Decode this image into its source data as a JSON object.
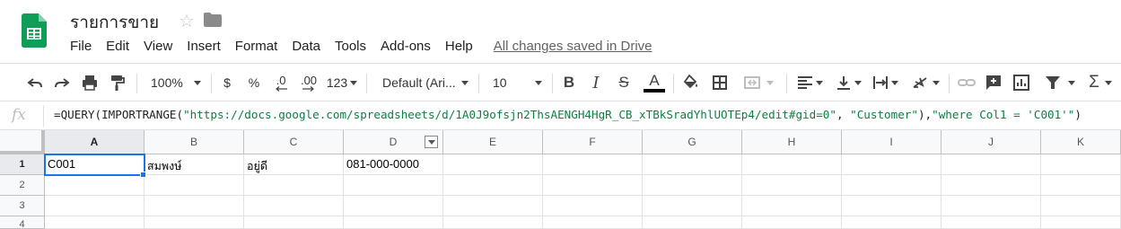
{
  "app": {
    "doc_title": "รายการขาย",
    "star_icon": "star-icon",
    "folder_icon": "folder-icon",
    "accent_color": "#0f9d58"
  },
  "menu": {
    "items": [
      "File",
      "Edit",
      "View",
      "Insert",
      "Format",
      "Data",
      "Tools",
      "Add-ons",
      "Help"
    ],
    "save_status": "All changes saved in Drive"
  },
  "toolbar": {
    "zoom": "100%",
    "currency": "$",
    "percent": "%",
    "decimal_decrease": ".0",
    "decimal_increase": ".00",
    "more_formats": "123",
    "font": "Default (Ari...",
    "font_size": "10",
    "bold": "B",
    "italic": "I",
    "strike": "S",
    "text_color_letter": "A"
  },
  "formula_bar": {
    "fx_label": "fx",
    "prefix": "=QUERY(IMPORTRANGE(",
    "url": "\"https://docs.google.com/spreadsheets/d/1A0J9ofsjn2ThsAENGH4HgR_CB_xTBkSradYhlUOTEp4/edit#gid=0\"",
    "middle": ", ",
    "sheet": "\"Customer\"",
    "mid2": "),",
    "query": "\"where Col1 = 'C001'\"",
    "suffix": ")"
  },
  "grid": {
    "columns": [
      "A",
      "B",
      "C",
      "D",
      "E",
      "F",
      "G",
      "H",
      "I",
      "J",
      "K"
    ],
    "rows": [
      "1",
      "2",
      "3",
      "4"
    ],
    "row1": [
      "C001",
      "สมพงษ์",
      "อยู่ดี",
      "081-000-0000"
    ],
    "selected_cell": "A1"
  }
}
